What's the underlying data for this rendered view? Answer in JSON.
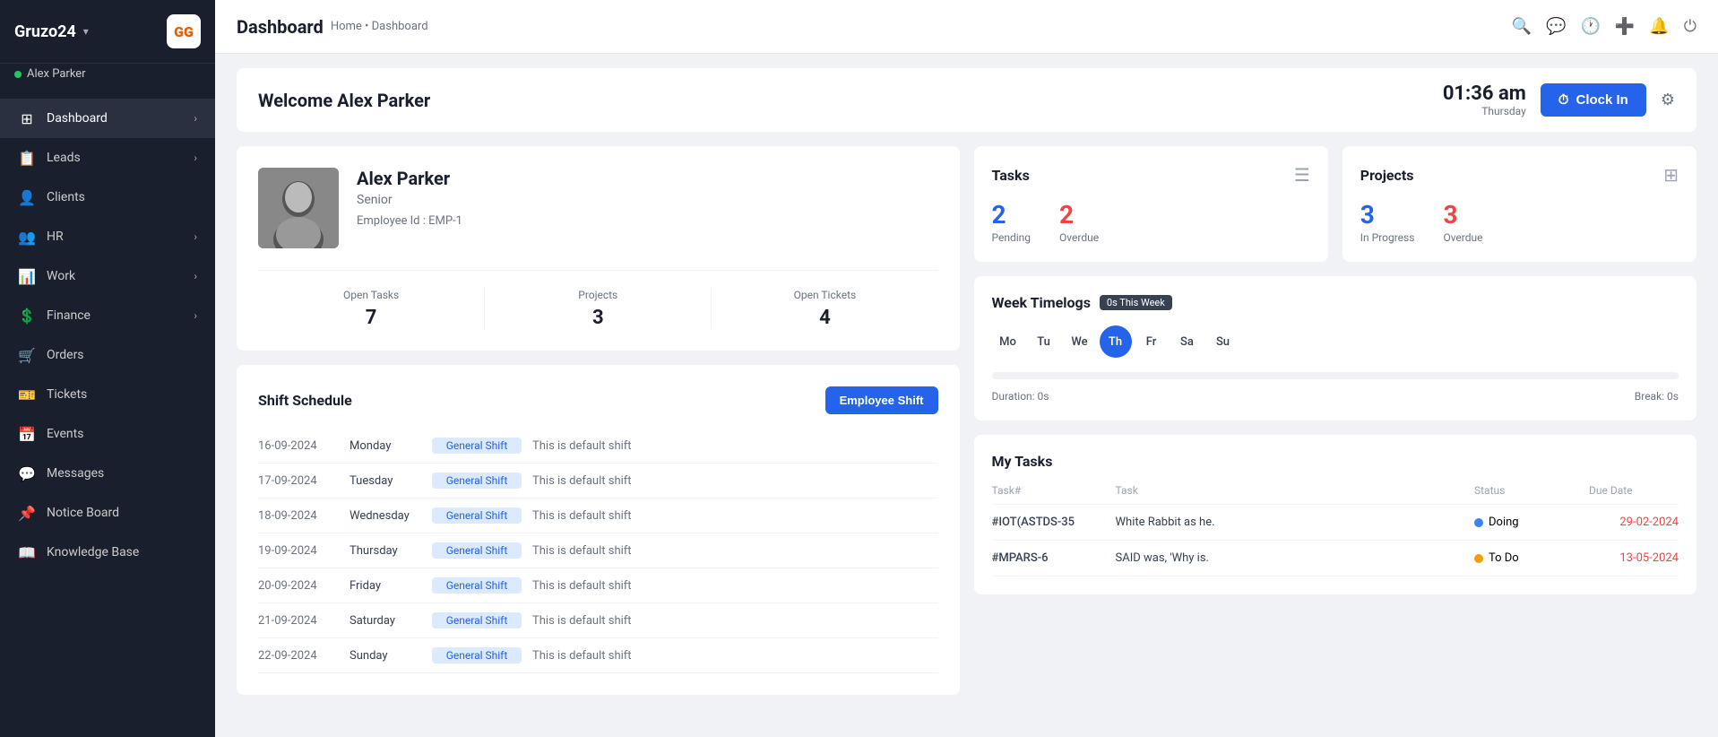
{
  "brand": {
    "name": "Gruzo24",
    "logo": "GG",
    "user": "Alex Parker",
    "user_status": "online"
  },
  "sidebar": {
    "items": [
      {
        "id": "dashboard",
        "label": "Dashboard",
        "icon": "⊞",
        "active": true,
        "has_children": true
      },
      {
        "id": "leads",
        "label": "Leads",
        "icon": "📋",
        "active": false,
        "has_children": true
      },
      {
        "id": "clients",
        "label": "Clients",
        "icon": "👤",
        "active": false,
        "has_children": false
      },
      {
        "id": "hr",
        "label": "HR",
        "icon": "👥",
        "active": false,
        "has_children": true
      },
      {
        "id": "work",
        "label": "Work",
        "icon": "📊",
        "active": false,
        "has_children": true
      },
      {
        "id": "finance",
        "label": "Finance",
        "icon": "💲",
        "active": false,
        "has_children": true
      },
      {
        "id": "orders",
        "label": "Orders",
        "icon": "🛒",
        "active": false,
        "has_children": false
      },
      {
        "id": "tickets",
        "label": "Tickets",
        "icon": "🎫",
        "active": false,
        "has_children": false
      },
      {
        "id": "events",
        "label": "Events",
        "icon": "📅",
        "active": false,
        "has_children": false
      },
      {
        "id": "messages",
        "label": "Messages",
        "icon": "💬",
        "active": false,
        "has_children": false
      },
      {
        "id": "noticeboard",
        "label": "Notice Board",
        "icon": "📌",
        "active": false,
        "has_children": false
      },
      {
        "id": "knowledgebase",
        "label": "Knowledge Base",
        "icon": "📖",
        "active": false,
        "has_children": false
      }
    ]
  },
  "topbar": {
    "title": "Dashboard",
    "breadcrumb": "Home • Dashboard"
  },
  "welcome": {
    "greeting": "Welcome Alex Parker",
    "time": "01:36 am",
    "day": "Thursday",
    "clock_in_label": "Clock In"
  },
  "profile": {
    "name": "Alex Parker",
    "role": "Senior",
    "employee_id": "Employee Id : EMP-1",
    "open_tasks_label": "Open Tasks",
    "open_tasks_value": "7",
    "projects_label": "Projects",
    "projects_value": "3",
    "open_tickets_label": "Open Tickets",
    "open_tickets_value": "4"
  },
  "tasks_widget": {
    "title": "Tasks",
    "pending_value": "2",
    "pending_label": "Pending",
    "overdue_value": "2",
    "overdue_label": "Overdue"
  },
  "projects_widget": {
    "title": "Projects",
    "in_progress_value": "3",
    "in_progress_label": "In Progress",
    "overdue_value": "3",
    "overdue_label": "Overdue"
  },
  "timelogs": {
    "title": "Week Timelogs",
    "badge": "0s This Week",
    "days": [
      "Mo",
      "Tu",
      "We",
      "Th",
      "Fr",
      "Sa",
      "Su"
    ],
    "active_day": "Th",
    "duration": "Duration: 0s",
    "break": "Break: 0s",
    "bar_percent": 0
  },
  "shift_schedule": {
    "title": "Shift Schedule",
    "employee_shift_btn": "Employee Shift",
    "rows": [
      {
        "date": "16-09-2024",
        "day": "Monday",
        "shift": "General Shift",
        "desc": "This is default shift"
      },
      {
        "date": "17-09-2024",
        "day": "Tuesday",
        "shift": "General Shift",
        "desc": "This is default shift"
      },
      {
        "date": "18-09-2024",
        "day": "Wednesday",
        "shift": "General Shift",
        "desc": "This is default shift"
      },
      {
        "date": "19-09-2024",
        "day": "Thursday",
        "shift": "General Shift",
        "desc": "This is default shift"
      },
      {
        "date": "20-09-2024",
        "day": "Friday",
        "shift": "General Shift",
        "desc": "This is default shift"
      },
      {
        "date": "21-09-2024",
        "day": "Saturday",
        "shift": "General Shift",
        "desc": "This is default shift"
      },
      {
        "date": "22-09-2024",
        "day": "Sunday",
        "shift": "General Shift",
        "desc": "This is default shift"
      }
    ]
  },
  "my_tasks": {
    "title": "My Tasks",
    "columns": [
      "Task#",
      "Task",
      "Status",
      "Due Date"
    ],
    "rows": [
      {
        "id": "#IOT(ASTDS-35",
        "task": "White Rabbit as he.",
        "status": "Doing",
        "status_type": "doing",
        "due": "29-02-2024",
        "overdue": true
      },
      {
        "id": "#MPARS-6",
        "task": "SAID was, 'Why is.",
        "status": "To Do",
        "status_type": "todo",
        "due": "13-05-2024",
        "overdue": true
      }
    ]
  },
  "colors": {
    "blue": "#2563eb",
    "red": "#ef4444",
    "green": "#22c55e",
    "yellow": "#f59e0b",
    "sidebar_bg": "#1a1f2e"
  }
}
